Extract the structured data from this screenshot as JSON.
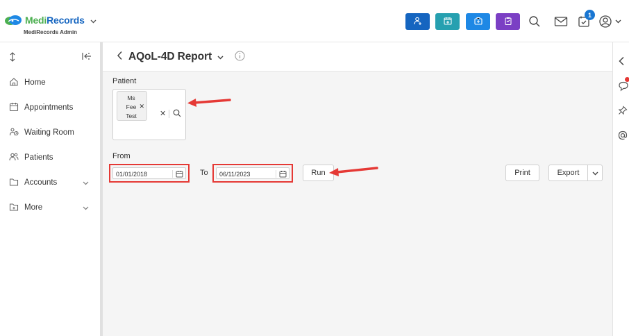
{
  "app": {
    "logo_medi": "Medi",
    "logo_records": "Records",
    "logo_subtitle": "MediRecords Admin",
    "notification_count": "1"
  },
  "topbar": {
    "quick_buttons": [
      {
        "name": "add-patient-button",
        "color": "#1565c0",
        "icon": "person-plus-icon"
      },
      {
        "name": "add-appointment-button",
        "color": "#26a0b0",
        "icon": "calendar-plus-icon"
      },
      {
        "name": "add-medical-button",
        "color": "#1e88e5",
        "icon": "medical-bag-icon"
      },
      {
        "name": "add-task-button",
        "color": "#7b3fc4",
        "icon": "clipboard-icon"
      }
    ]
  },
  "sidebar": {
    "items": [
      {
        "label": "Home",
        "icon": "home-icon"
      },
      {
        "label": "Appointments",
        "icon": "calendar-icon"
      },
      {
        "label": "Waiting Room",
        "icon": "waiting-room-icon"
      },
      {
        "label": "Patients",
        "icon": "patients-icon"
      },
      {
        "label": "Accounts",
        "icon": "folder-icon",
        "expandable": true
      },
      {
        "label": "More",
        "icon": "more-icon",
        "expandable": true
      }
    ]
  },
  "report": {
    "title": "AQoL-4D Report",
    "patient_label": "Patient",
    "patient_chip": "Ms Fee Test",
    "patient_chip_lines": [
      "Ms",
      "Fee",
      "Test"
    ],
    "from_label": "From",
    "from_value": "01/01/2018",
    "to_label": "To",
    "to_value": "06/11/2023",
    "run_label": "Run",
    "print_label": "Print",
    "export_label": "Export"
  },
  "colors": {
    "highlight": "#e53935",
    "annotation_arrow": "#e53935"
  }
}
